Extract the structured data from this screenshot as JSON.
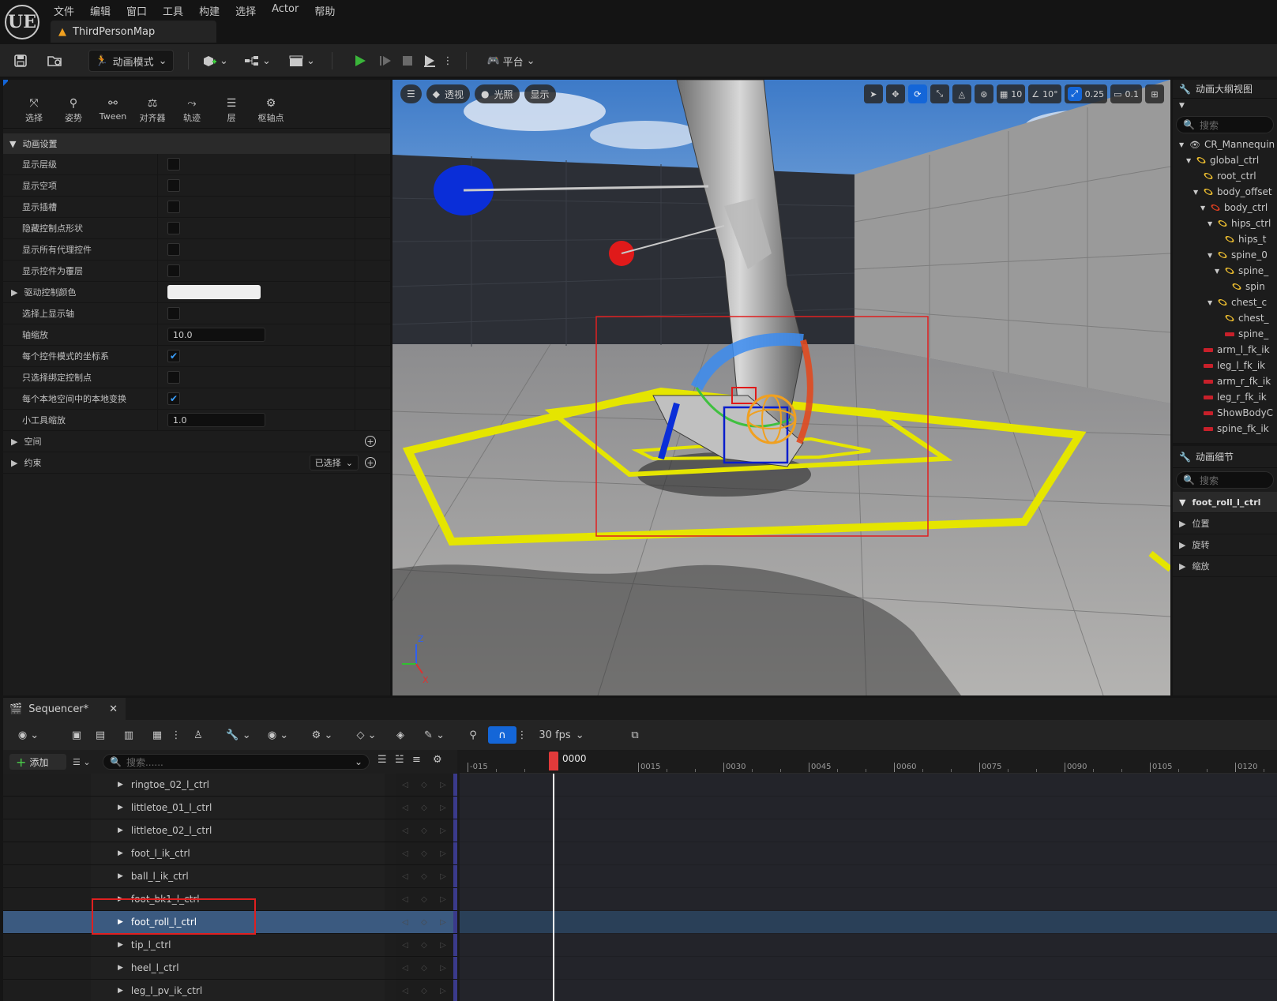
{
  "app": {
    "logo": "UE",
    "menus": [
      "文件",
      "编辑",
      "窗口",
      "工具",
      "构建",
      "选择",
      "Actor",
      "帮助"
    ],
    "map_tab": "ThirdPersonMap"
  },
  "toolbar": {
    "mode_label": "动画模式",
    "platform_label": "平台"
  },
  "left_panel": {
    "tools": [
      {
        "label": "选择",
        "icon": "select-icon"
      },
      {
        "label": "姿势",
        "icon": "pose-icon"
      },
      {
        "label": "Tween",
        "icon": "tween-icon"
      },
      {
        "label": "对齐器",
        "icon": "aligner-icon"
      },
      {
        "label": "轨迹",
        "icon": "trail-icon"
      },
      {
        "label": "层",
        "icon": "layer-icon"
      },
      {
        "label": "枢轴点",
        "icon": "pivot-icon"
      }
    ],
    "section_title": "动画设置",
    "props": [
      {
        "label": "显示层级",
        "type": "checkbox",
        "checked": false
      },
      {
        "label": "显示空项",
        "type": "checkbox",
        "checked": false
      },
      {
        "label": "显示插槽",
        "type": "checkbox",
        "checked": false
      },
      {
        "label": "隐藏控制点形状",
        "type": "checkbox",
        "checked": false
      },
      {
        "label": "显示所有代理控件",
        "type": "checkbox",
        "checked": false
      },
      {
        "label": "显示控件为覆层",
        "type": "checkbox",
        "checked": false
      },
      {
        "label": "驱动控制颜色",
        "type": "color",
        "value": "#efefef"
      },
      {
        "label": "选择上显示轴",
        "type": "checkbox",
        "checked": false
      },
      {
        "label": "轴缩放",
        "type": "number",
        "value": "10.0"
      },
      {
        "label": "每个控件模式的坐标系",
        "type": "checkbox",
        "checked": true
      },
      {
        "label": "只选择绑定控制点",
        "type": "checkbox",
        "checked": false
      },
      {
        "label": "每个本地空间中的本地变换",
        "type": "checkbox",
        "checked": true
      },
      {
        "label": "小工具缩放",
        "type": "number",
        "value": "1.0"
      }
    ],
    "space_label": "空间",
    "constraint_label": "约束",
    "constraint_dropdown": "已选择"
  },
  "viewport": {
    "menu_icon": "hamburger-icon",
    "perspective_label": "透视",
    "lighting_label": "光照",
    "show_label": "显示",
    "grid_snap": "10",
    "rot_snap": "10°",
    "scale_snap": "0.25",
    "camera_speed": "0.1"
  },
  "outliner": {
    "title": "动画大纲视图",
    "search_placeholder": "搜索",
    "items": [
      {
        "label": "CR_Mannequin",
        "indent": 0,
        "icon": "eye"
      },
      {
        "label": "global_ctrl",
        "indent": 1,
        "icon": "ctrl"
      },
      {
        "label": "root_ctrl",
        "indent": 2,
        "icon": "ctrl"
      },
      {
        "label": "body_offset",
        "indent": 2,
        "icon": "ctrl"
      },
      {
        "label": "body_ctrl",
        "indent": 3,
        "icon": "ctrl-red"
      },
      {
        "label": "hips_ctrl",
        "indent": 4,
        "icon": "ctrl"
      },
      {
        "label": "hips_t",
        "indent": 5,
        "icon": "ctrl"
      },
      {
        "label": "spine_0",
        "indent": 4,
        "icon": "ctrl"
      },
      {
        "label": "spine_",
        "indent": 5,
        "icon": "ctrl"
      },
      {
        "label": "spin",
        "indent": 6,
        "icon": "ctrl"
      },
      {
        "label": "chest_c",
        "indent": 4,
        "icon": "ctrl"
      },
      {
        "label": "chest_",
        "indent": 5,
        "icon": "ctrl"
      },
      {
        "label": "spine_",
        "indent": 5,
        "icon": "bar"
      },
      {
        "label": "arm_l_fk_ik",
        "indent": 2,
        "icon": "bar"
      },
      {
        "label": "leg_l_fk_ik",
        "indent": 2,
        "icon": "bar"
      },
      {
        "label": "arm_r_fk_ik",
        "indent": 2,
        "icon": "bar"
      },
      {
        "label": "leg_r_fk_ik",
        "indent": 2,
        "icon": "bar"
      },
      {
        "label": "ShowBodyC",
        "indent": 2,
        "icon": "bar"
      },
      {
        "label": "spine_fk_ik",
        "indent": 2,
        "icon": "bar"
      }
    ]
  },
  "details": {
    "title": "动画细节",
    "search_placeholder": "搜索",
    "control_name": "foot_roll_l_ctrl",
    "sections": [
      "位置",
      "旋转",
      "缩放"
    ]
  },
  "sequencer": {
    "tab_title": "Sequencer*",
    "fps_label": "30 fps",
    "add_label": "添加",
    "search_placeholder": "搜索......",
    "playhead_frame": "0000",
    "ruler_ticks": [
      "-015",
      "0015",
      "0030",
      "0045",
      "0060",
      "0075",
      "0090",
      "0105",
      "0120"
    ],
    "tracks": [
      {
        "name": "ringtoe_02_l_ctrl",
        "selected": false
      },
      {
        "name": "littletoe_01_l_ctrl",
        "selected": false
      },
      {
        "name": "littletoe_02_l_ctrl",
        "selected": false
      },
      {
        "name": "foot_l_ik_ctrl",
        "selected": false
      },
      {
        "name": "ball_l_ik_ctrl",
        "selected": false
      },
      {
        "name": "foot_bk1_l_ctrl",
        "selected": false
      },
      {
        "name": "foot_roll_l_ctrl",
        "selected": true
      },
      {
        "name": "tip_l_ctrl",
        "selected": false
      },
      {
        "name": "heel_l_ctrl",
        "selected": false
      },
      {
        "name": "leg_l_pv_ik_ctrl",
        "selected": false
      }
    ]
  },
  "colors": {
    "accent": "#1466d8",
    "playhead": "#e23a3a",
    "selection": "#3b5a80",
    "highlight_box": "#e02020"
  }
}
